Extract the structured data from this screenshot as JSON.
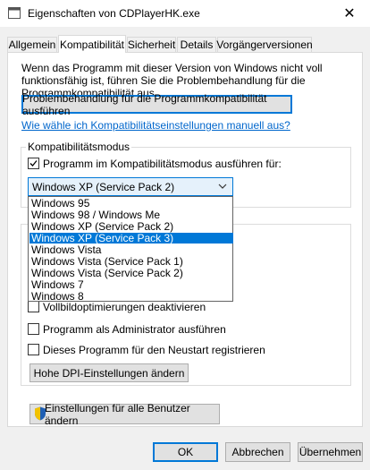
{
  "window": {
    "title": "Eigenschaften von CDPlayerHK.exe",
    "close_glyph": "✕"
  },
  "tabs": [
    {
      "label": "Allgemein"
    },
    {
      "label": "Kompatibilität"
    },
    {
      "label": "Sicherheit"
    },
    {
      "label": "Details"
    },
    {
      "label": "Vorgängerversionen"
    }
  ],
  "active_tab": "Kompatibilität",
  "intro_text": "Wenn das Programm mit dieser Version von Windows nicht voll funktionsfähig ist, führen Sie die Problembehandlung für die Programmkompatibilität aus.",
  "troubleshoot_button": "Problembehandlung für die Programmkompatibilität ausführen",
  "help_link": "Wie wähle ich Kompatibilitätseinstellungen manuell aus?",
  "compat_mode": {
    "group_label": "Kompatibilitätsmodus",
    "checkbox_label": "Programm im Kompatibilitätsmodus ausführen für:",
    "checked": true,
    "selected_value": "Windows XP (Service Pack 2)",
    "options": [
      "Windows 95",
      "Windows 98 / Windows Me",
      "Windows XP (Service Pack 2)",
      "Windows XP (Service Pack 3)",
      "Windows Vista",
      "Windows Vista (Service Pack 1)",
      "Windows Vista (Service Pack 2)",
      "Windows 7",
      "Windows 8"
    ],
    "highlighted_option": "Windows XP (Service Pack 3)"
  },
  "settings": {
    "checkboxes": [
      {
        "label": "Vollbildoptimierungen deaktivieren",
        "checked": false
      },
      {
        "label": "Programm als Administrator ausführen",
        "checked": false
      },
      {
        "label": "Dieses Programm für den Neustart registrieren",
        "checked": false
      }
    ],
    "dpi_button": "Hohe DPI-Einstellungen ändern"
  },
  "all_users_button": "Einstellungen für alle Benutzer ändern",
  "footer": {
    "ok": "OK",
    "cancel": "Abbrechen",
    "apply": "Übernehmen"
  },
  "colors": {
    "accent": "#0078d7",
    "link": "#0066cc",
    "shield_blue": "#1f5fb4",
    "shield_yellow": "#f2c200"
  }
}
